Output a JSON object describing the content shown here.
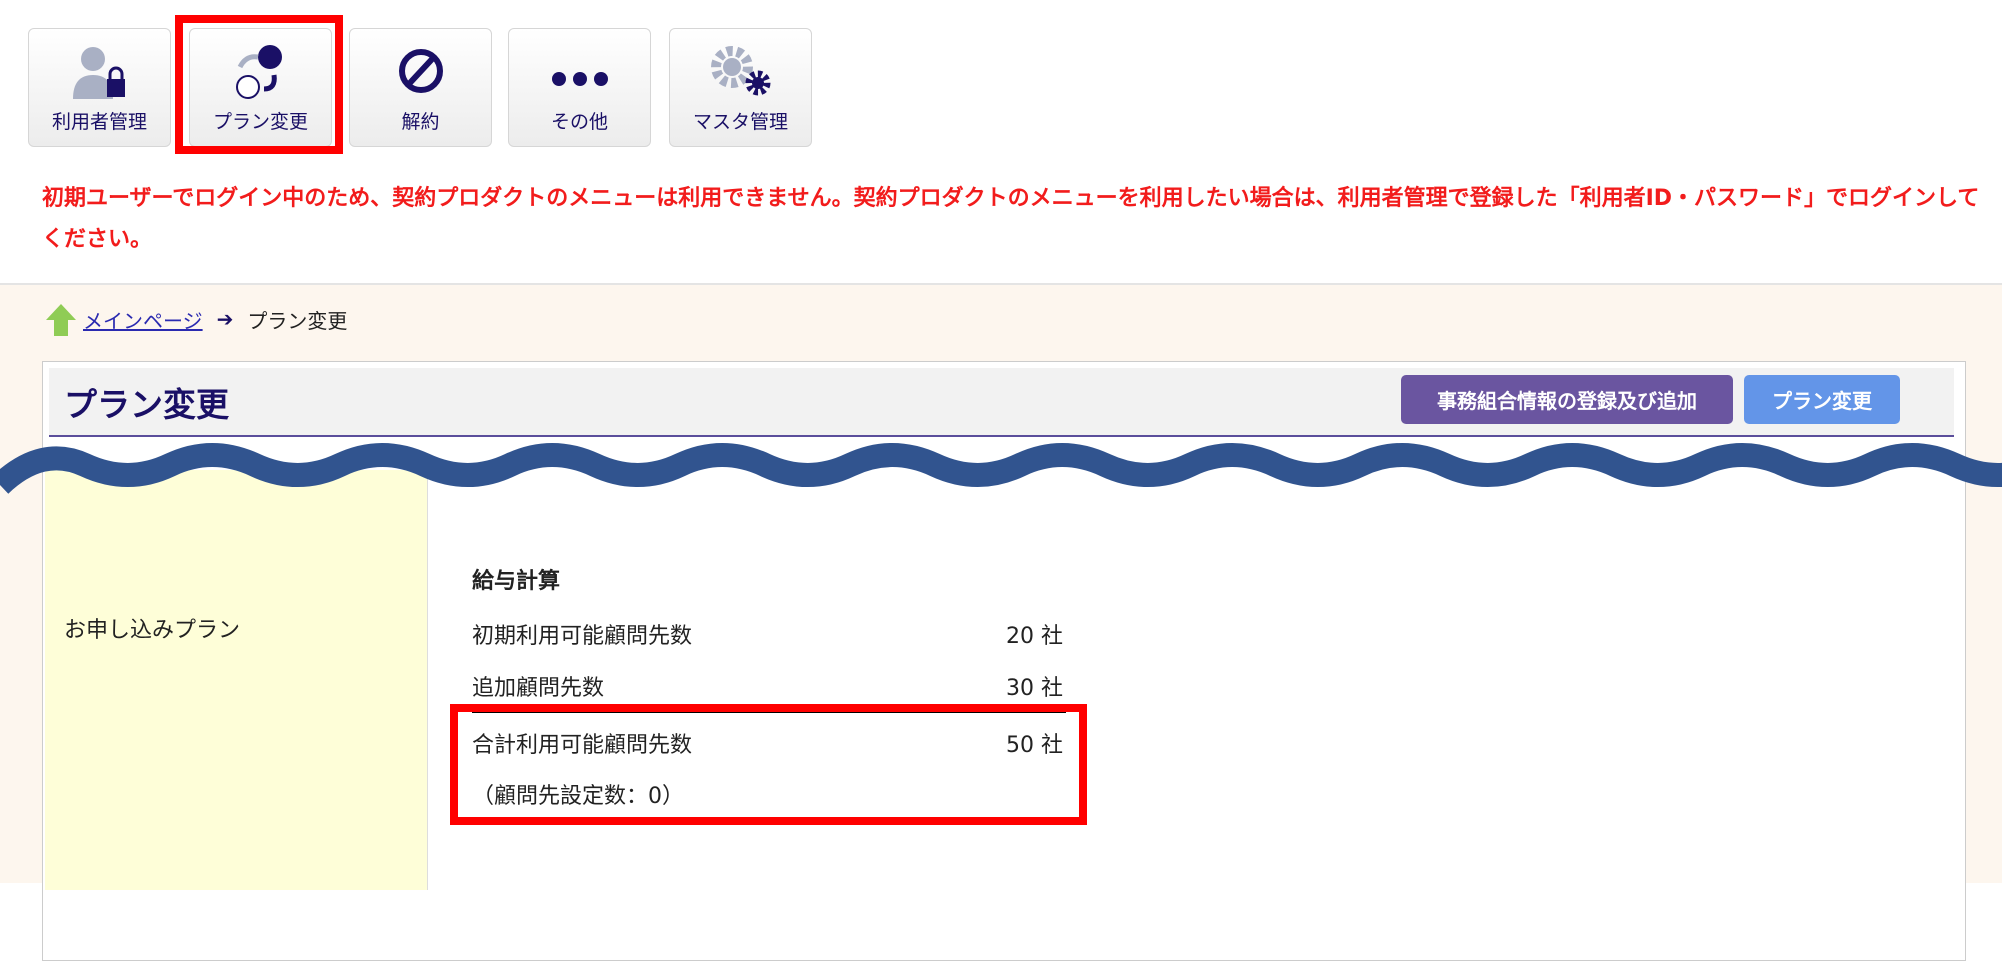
{
  "toolbar": [
    {
      "label": "利用者管理",
      "icon": "user-lock-icon"
    },
    {
      "label": "プラン変更",
      "icon": "plan-change-icon"
    },
    {
      "label": "解約",
      "icon": "prohibited-icon"
    },
    {
      "label": "その他",
      "icon": "more-dots-icon"
    },
    {
      "label": "マスタ管理",
      "icon": "gears-icon"
    }
  ],
  "notice": "初期ユーザーでログイン中のため、契約プロダクトのメニューは利用できません。契約プロダクトのメニューを利用したい場合は、利用者管理で登録した「利用者ID・パスワード」でログインしてください。",
  "breadcrumb": {
    "home": "メインページ",
    "current": "プラン変更"
  },
  "page": {
    "title": "プラン変更",
    "btn_register": "事務組合情報の登録及び追加",
    "btn_plan": "プラン変更"
  },
  "plan": {
    "label": "お申し込みプラン",
    "section": "給与計算",
    "rows": [
      {
        "label": "初期利用可能顧問先数",
        "value": "20 社"
      },
      {
        "label": "追加顧問先数",
        "value": "30 社"
      },
      {
        "label": "合計利用可能顧問先数",
        "value": "50 社"
      }
    ],
    "note": "（顧問先設定数：0）"
  },
  "colors": {
    "accent": "#1a1066",
    "purple": "#6a55a0",
    "blue": "#6395e8",
    "wave": "#31548f",
    "highlight": "#ff0000"
  }
}
